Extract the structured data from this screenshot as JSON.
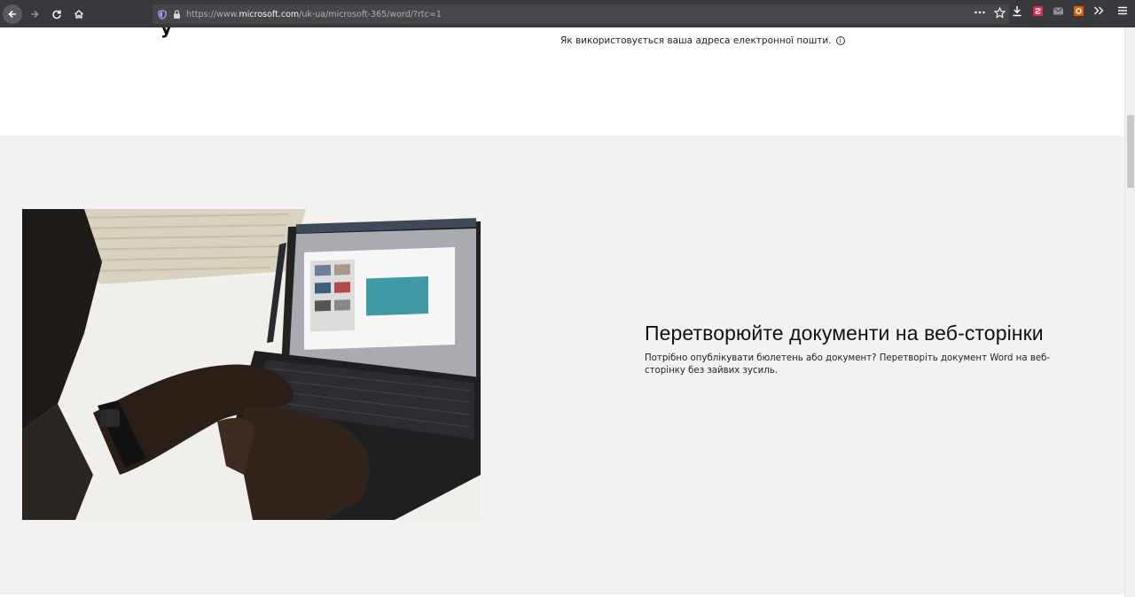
{
  "browser": {
    "url_prefix": "https://www.",
    "url_domain": "microsoft.com",
    "url_path": "/uk-ua/microsoft-365/word/?rtc=1",
    "page_actions_icon": "more-icon",
    "bookmark_icon": "star-icon"
  },
  "page": {
    "email_note": "Як використовується ваша адреса електронної пошти.",
    "feature": {
      "title": "Перетворюйте документи на веб-сторінки",
      "description": "Потрібно опублікувати бюлетень або документ? Перетворіть документ Word на веб-сторінку без зайвих зусиль."
    }
  },
  "colors": {
    "chrome": "#38383d",
    "urlbar": "#474749",
    "section_bg": "#f2f2f2"
  }
}
